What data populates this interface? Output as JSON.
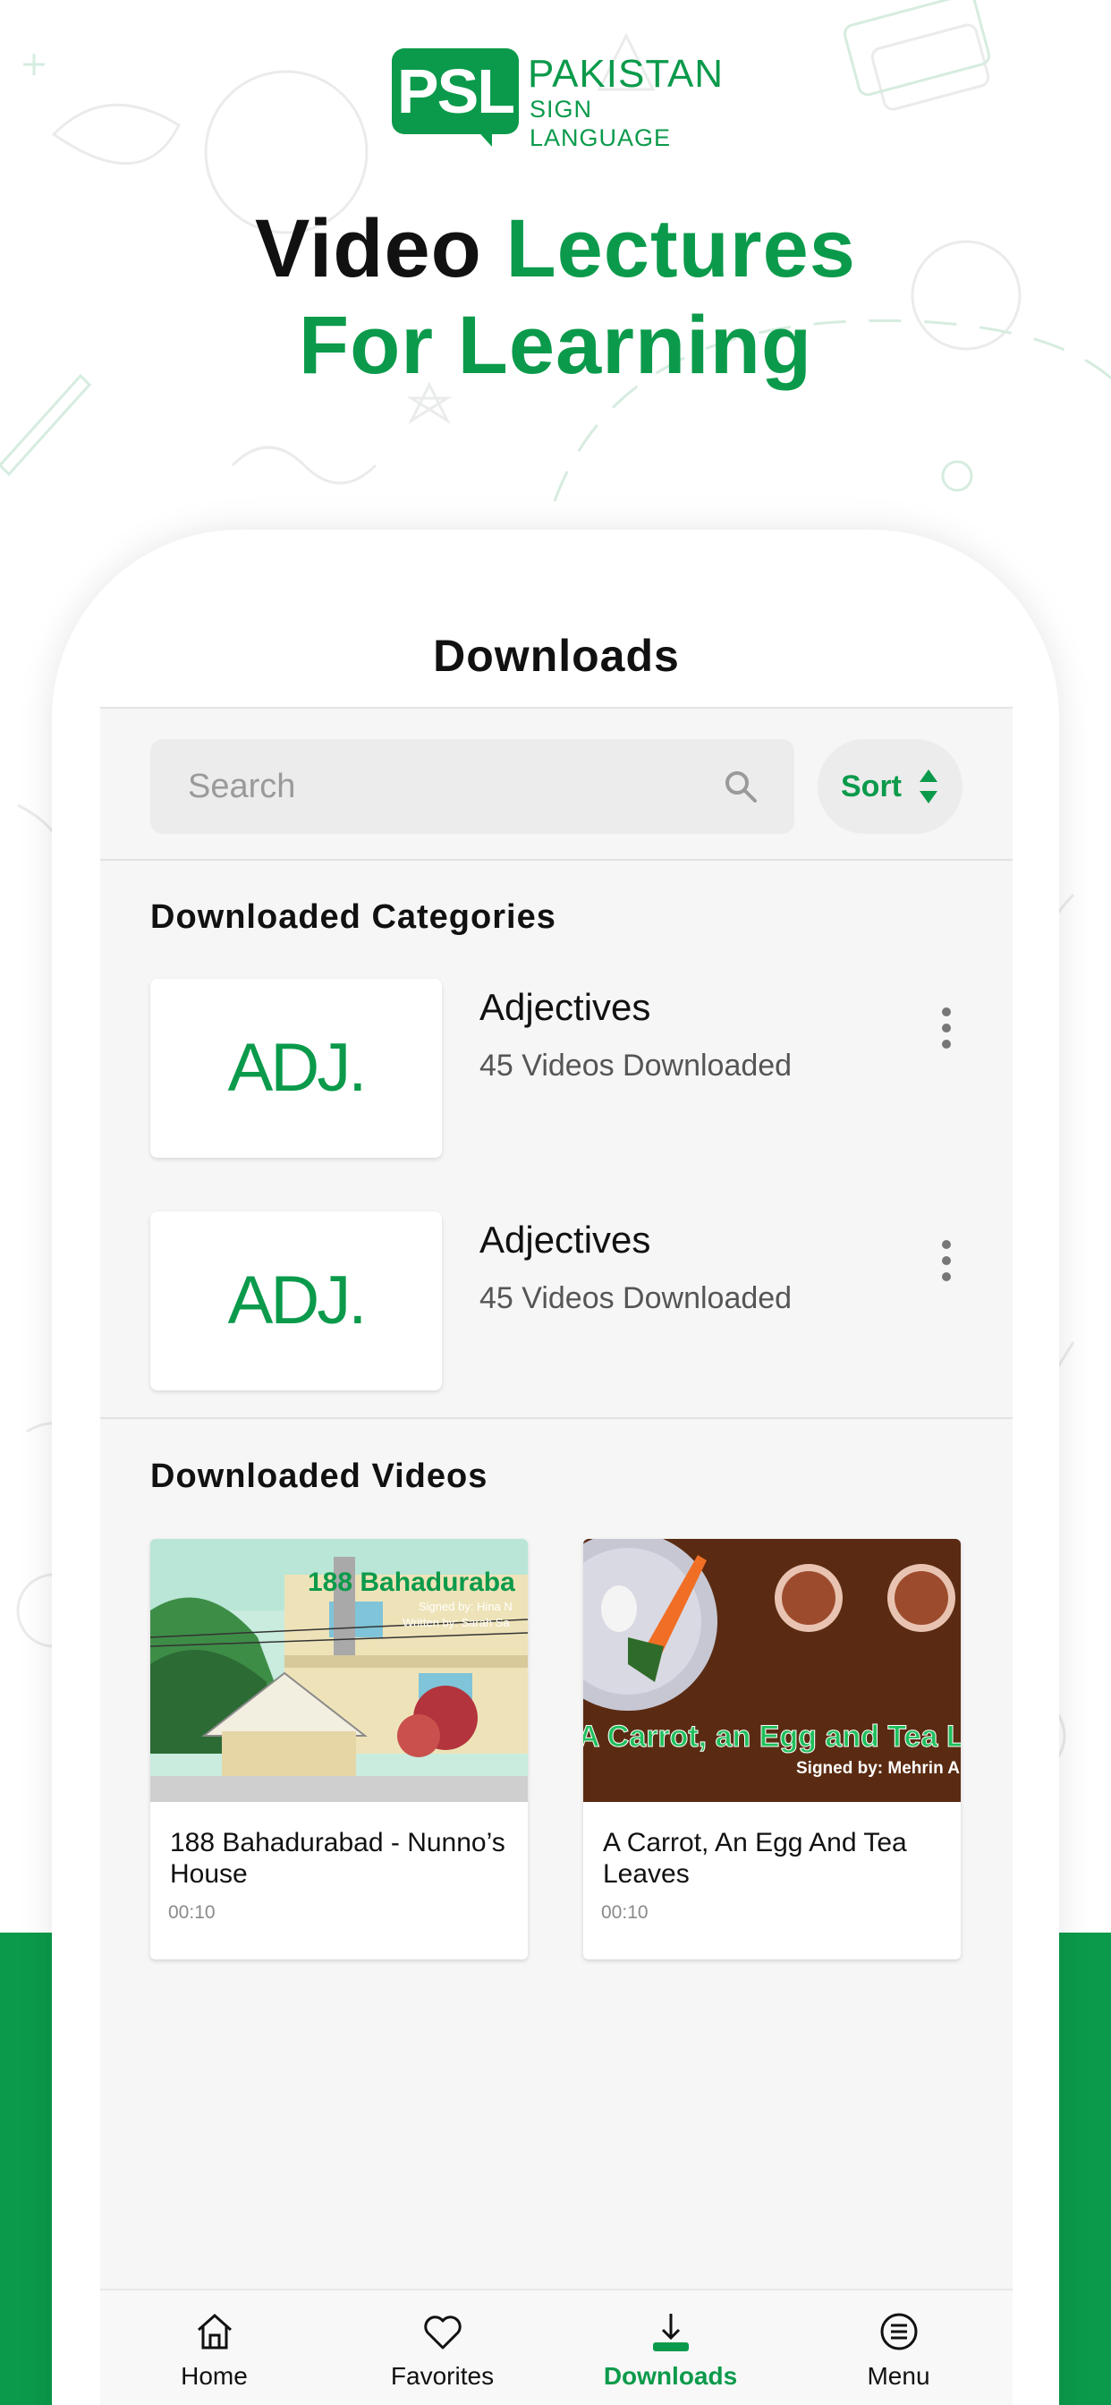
{
  "brand": {
    "logo_mark": "PSL",
    "logo_line1": "PAKISTAN",
    "logo_line2": "SIGN LANGUAGE",
    "accent_color": "#0b9a4b"
  },
  "headline": {
    "line1_black": "Video",
    "line1_green": "Lectures",
    "line2_green": "For Learning"
  },
  "app": {
    "title": "Downloads",
    "search": {
      "placeholder": "Search",
      "icon": "search-icon"
    },
    "sort": {
      "label": "Sort",
      "icon": "sort-arrows-icon"
    },
    "categories_section": {
      "title": "Downloaded Categories",
      "items": [
        {
          "thumb_text": "ADJ.",
          "name": "Adjectives",
          "count": "45 Videos Downloaded"
        },
        {
          "thumb_text": "ADJ.",
          "name": "Adjectives",
          "count": "45 Videos Downloaded"
        }
      ]
    },
    "videos_section": {
      "title": "Downloaded Videos",
      "items": [
        {
          "title": "188 Bahadurabad - Nunno’s House",
          "duration": "00:10",
          "thumb_caption": "188 Bahaduraba",
          "thumb_signed": "Signed by: Hina N",
          "thumb_written": "Written by: Sarah Sa"
        },
        {
          "title": "A Carrot, An Egg And Tea Leaves",
          "duration": "00:10",
          "thumb_caption": "A Carrot, an Egg and Tea Leav",
          "thumb_signed": "Signed by: Mehrin Al"
        }
      ]
    },
    "nav": {
      "items": [
        {
          "label": "Home",
          "icon": "home-icon",
          "active": false
        },
        {
          "label": "Favorites",
          "icon": "heart-icon",
          "active": false
        },
        {
          "label": "Downloads",
          "icon": "download-icon",
          "active": true
        },
        {
          "label": "Menu",
          "icon": "menu-icon",
          "active": false
        }
      ]
    }
  }
}
